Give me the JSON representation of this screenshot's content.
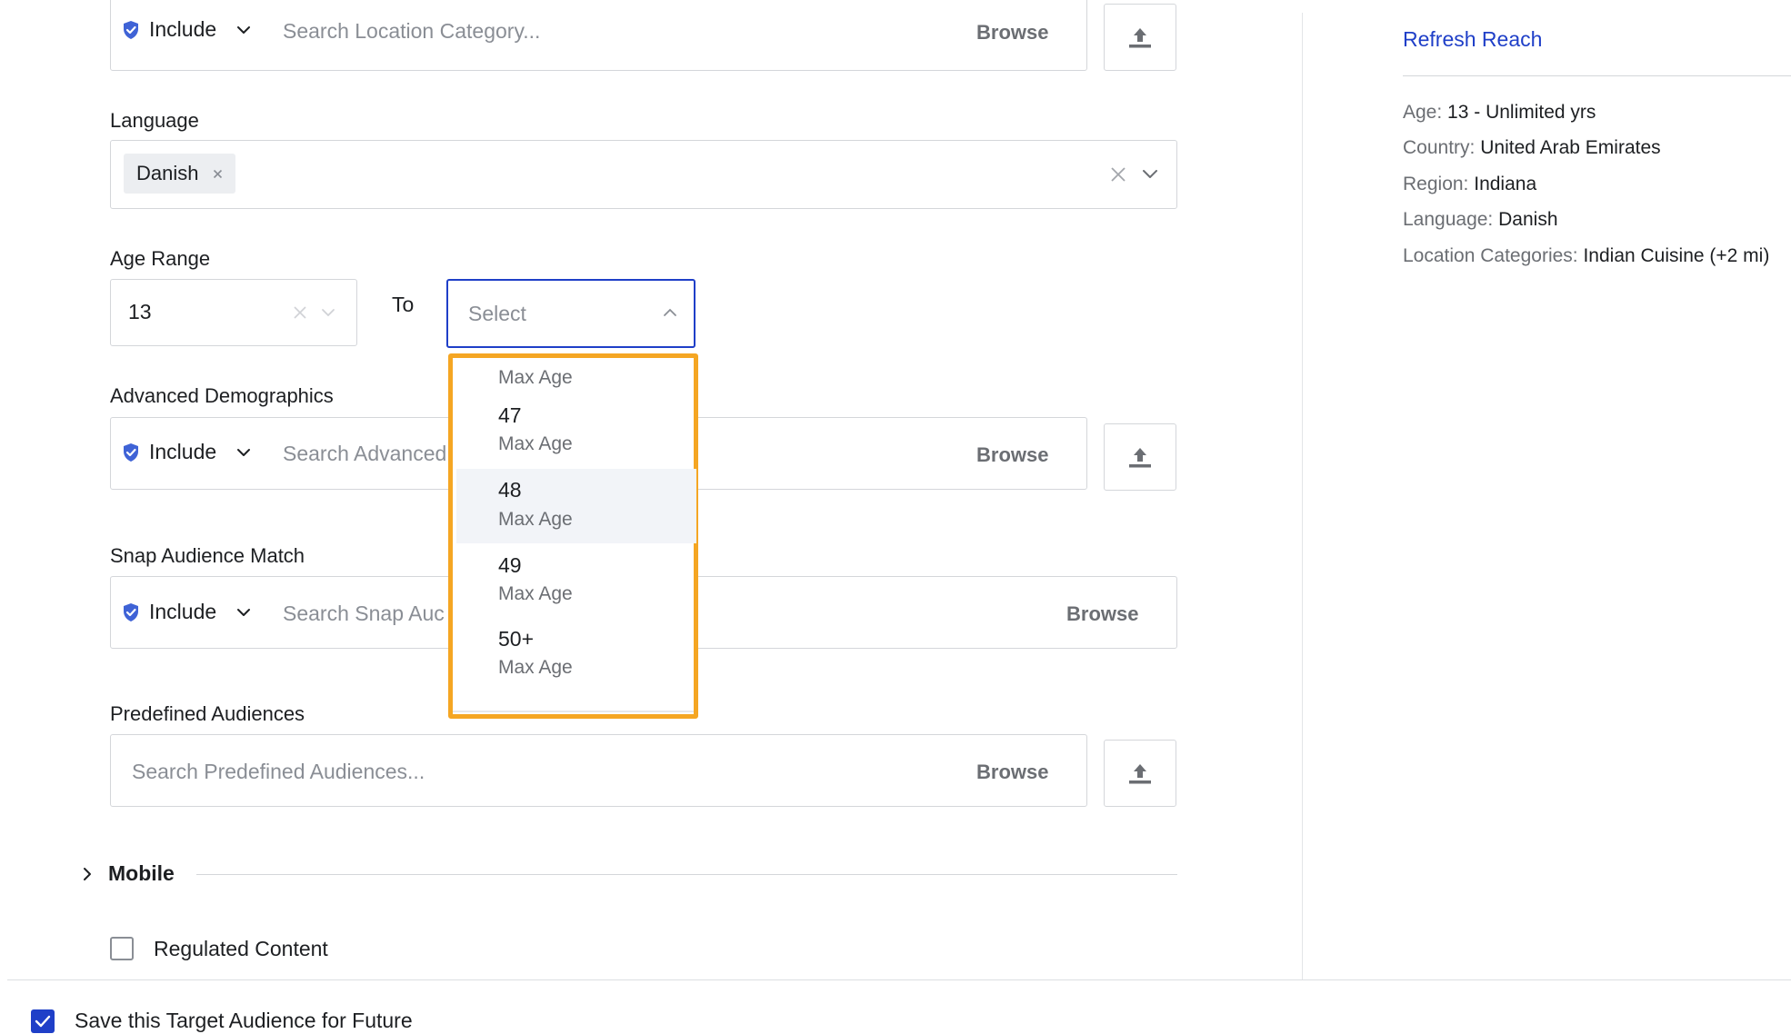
{
  "location": {
    "include_label": "Include",
    "placeholder": "Search Location Category...",
    "browse": "Browse"
  },
  "language": {
    "label": "Language",
    "selected_tag": "Danish"
  },
  "age_range": {
    "label": "Age Range",
    "min_value": "13",
    "to_label": "To",
    "max_placeholder": "Select",
    "dropdown": {
      "partial_sub": "Max Age",
      "options": [
        {
          "value": "47",
          "sub": "Max Age"
        },
        {
          "value": "48",
          "sub": "Max Age"
        },
        {
          "value": "49",
          "sub": "Max Age"
        },
        {
          "value": "50+",
          "sub": "Max Age"
        }
      ]
    }
  },
  "advanced_demographics": {
    "label": "Advanced Demographics",
    "include_label": "Include",
    "placeholder": "Search Advanced",
    "browse": "Browse"
  },
  "snap_audience_match": {
    "label": "Snap Audience Match",
    "include_label": "Include",
    "placeholder": "Search Snap Auc",
    "browse": "Browse"
  },
  "predefined_audiences": {
    "label": "Predefined Audiences",
    "placeholder": "Search Predefined Audiences...",
    "browse": "Browse"
  },
  "mobile": {
    "label": "Mobile"
  },
  "regulated_content": {
    "label": "Regulated Content",
    "checked": false
  },
  "save_audience": {
    "label": "Save this Target Audience for Future",
    "checked": true
  },
  "summary": {
    "refresh_label": "Refresh Reach",
    "rows": [
      {
        "key": "Age:",
        "value": "13 - Unlimited yrs"
      },
      {
        "key": "Country:",
        "value": "United Arab Emirates"
      },
      {
        "key": "Region:",
        "value": "Indiana"
      },
      {
        "key": "Language:",
        "value": "Danish"
      },
      {
        "key": "Location Categories:",
        "value": "Indian Cuisine (+2 mi)"
      }
    ]
  },
  "colors": {
    "accent": "#1f3fc8",
    "include_shield": "#3f63d6",
    "dropdown_highlight": "#f5a623",
    "checkbox_checked": "#1f3fc8"
  },
  "icons": [
    "shield-check-icon",
    "chevron-down-icon",
    "upload-icon",
    "close-icon",
    "chevron-up-icon",
    "chevron-right-icon"
  ]
}
